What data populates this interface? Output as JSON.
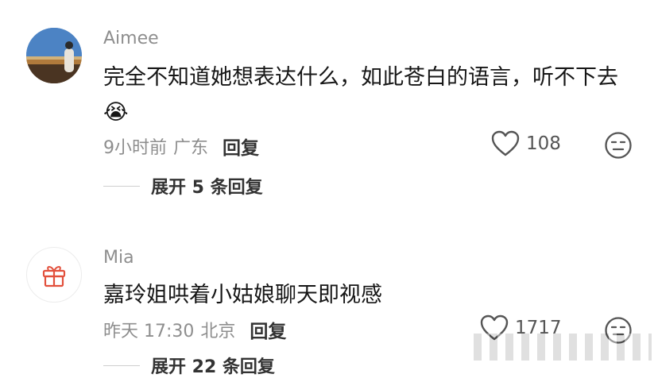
{
  "comments": [
    {
      "username": "Aimee",
      "text": "完全不知道她想表达什么，如此苍白的语言，听不下去",
      "emoji": "😭",
      "time": "9小时前",
      "location": "广东",
      "reply_label": "回复",
      "likes": "108",
      "expand_label": "展开 5 条回复"
    },
    {
      "username": "Mia",
      "text": "嘉玲姐哄着小姑娘聊天即视感",
      "time": "昨天 17:30",
      "location": "北京",
      "reply_label": "回复",
      "likes": "1717",
      "expand_label": "展开 22 条回复"
    }
  ],
  "icons": {
    "like": "heart-outline-icon",
    "dislike": "neutral-face-icon",
    "gift": "gift-icon"
  },
  "colors": {
    "gift_accent": "#e2503c",
    "muted_text": "#8e8e8e",
    "body_text": "#161616"
  }
}
